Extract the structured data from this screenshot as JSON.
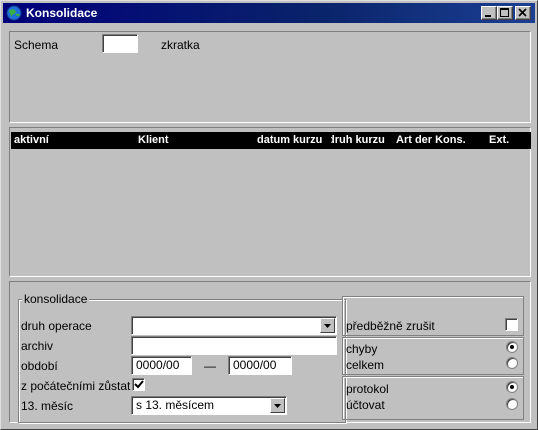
{
  "window": {
    "title": "Konsolidace"
  },
  "top_section": {
    "schema_label": "Schema",
    "schema_value": "",
    "abbr_label": "zkratka"
  },
  "table": {
    "columns": [
      "aktivní",
      "Klient",
      "datum kurzu",
      "druh kurzu",
      "Art der Kons.",
      "Ext."
    ],
    "rows": []
  },
  "consolidation": {
    "group_title": "konsolidace",
    "operation_type_label": "druh operace",
    "operation_type_value": "",
    "archive_label": "archiv",
    "archive_value": "",
    "period_label": "období",
    "period_from": "0000/00",
    "period_separator": "—",
    "period_to": "0000/00",
    "keep_initial_label": "z počátečními zůstat",
    "keep_initial_checked": true,
    "month13_label": "13. měsíc",
    "month13_value": "s 13. měsícem"
  },
  "options": {
    "cancel_preliminary_label": "předběžně zrušit",
    "cancel_preliminary_checked": false,
    "errors_label": "chyby",
    "total_label": "celkem",
    "errors_selected": true,
    "protocol_label": "protokol",
    "post_label": "účtovat",
    "protocol_selected": true
  },
  "colors": {
    "titlebar": "#0a246a",
    "face": "#c0c0c0",
    "header": "#000000"
  }
}
